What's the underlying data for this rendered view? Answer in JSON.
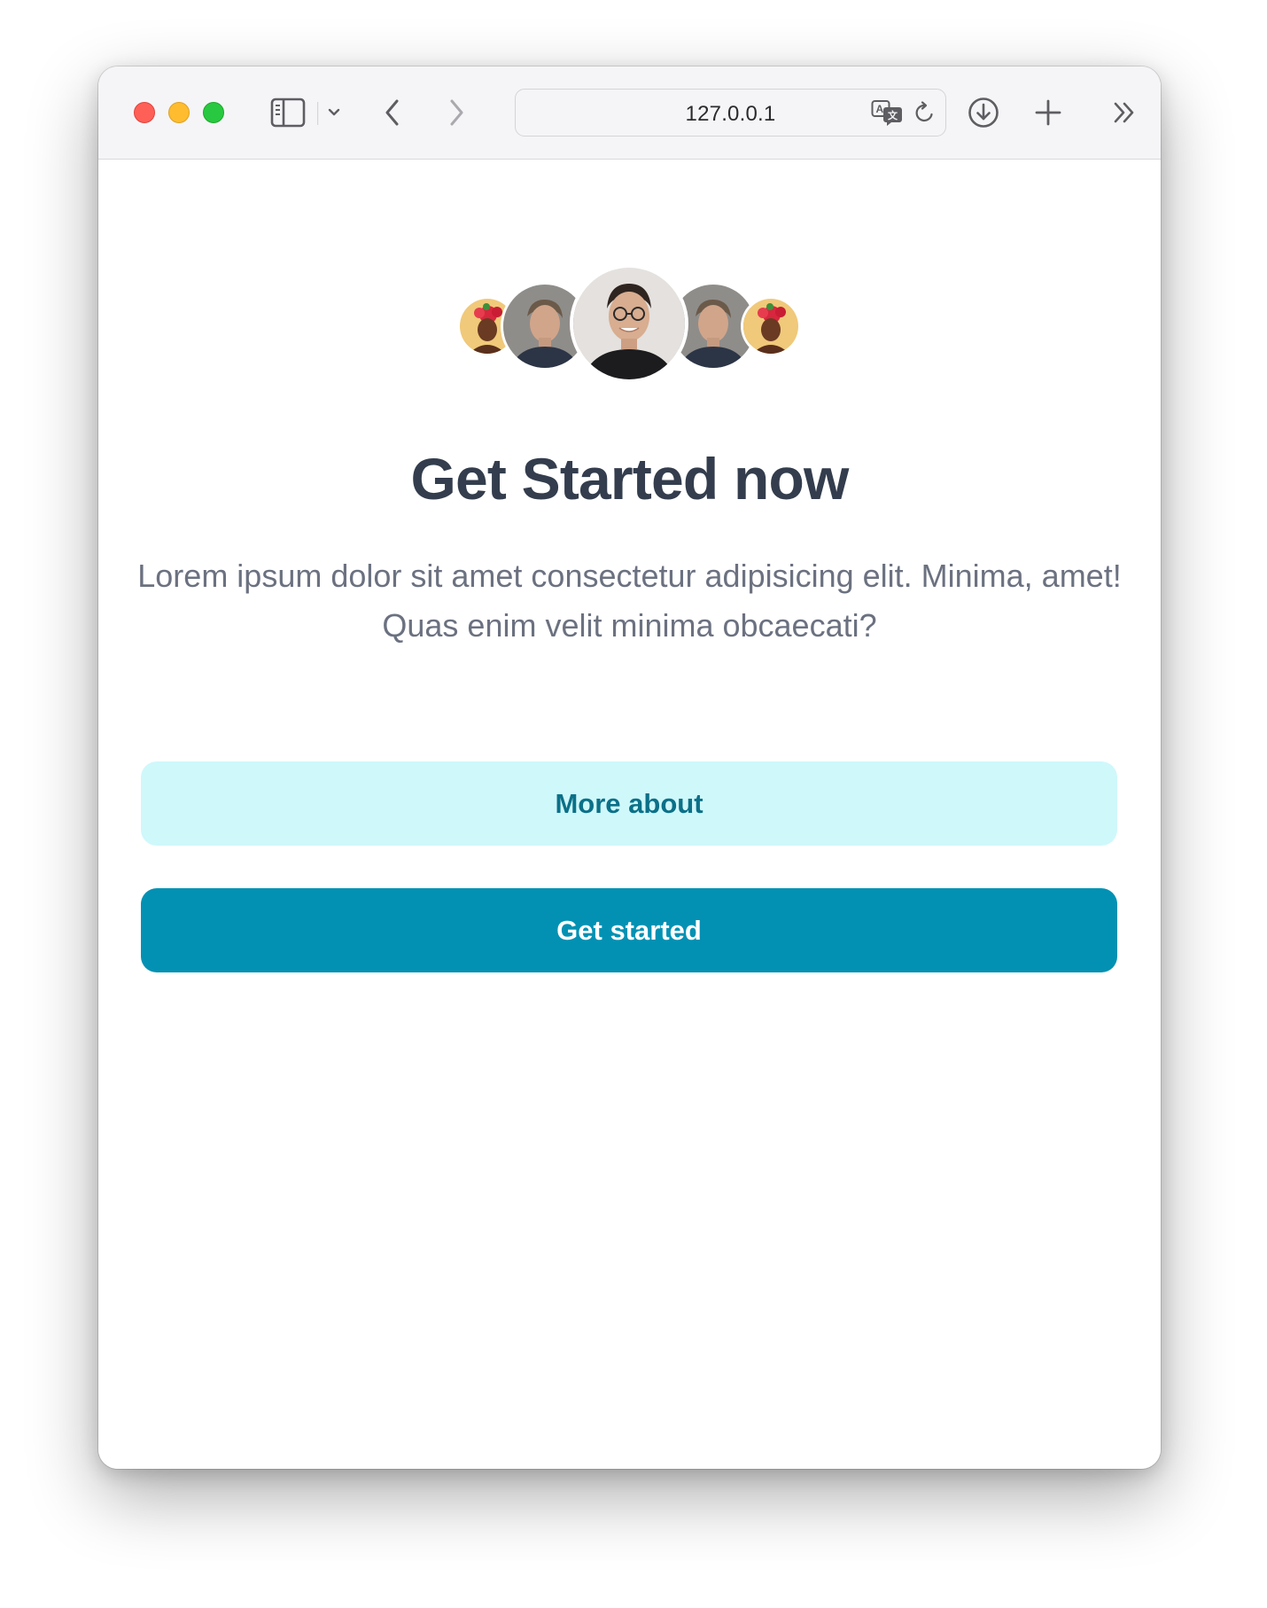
{
  "browser": {
    "url": "127.0.0.1",
    "traffic_lights": [
      "close",
      "minimize",
      "zoom"
    ],
    "toolbar_icons": [
      "sidebar-icon",
      "chevron-down-icon",
      "back-icon",
      "forward-icon",
      "translate-icon",
      "reload-icon",
      "download-icon",
      "new-tab-icon",
      "more-icon"
    ]
  },
  "page": {
    "avatars": [
      "avatar-woman-flowers",
      "avatar-man",
      "avatar-man-glasses",
      "avatar-man",
      "avatar-woman-flowers"
    ],
    "title": "Get Started now",
    "description": "Lorem ipsum dolor sit amet consectetur adipisicing elit. Minima, amet! Quas enim velit minima obcaecati?",
    "more_button_label": "More about",
    "start_button_label": "Get started"
  },
  "colors": {
    "title": "#333d4d",
    "text": "#6b7180",
    "secondary_bg": "#cff8fb",
    "secondary_text": "#0b7088",
    "primary_bg": "#0291b3",
    "primary_text": "#ffffff"
  }
}
